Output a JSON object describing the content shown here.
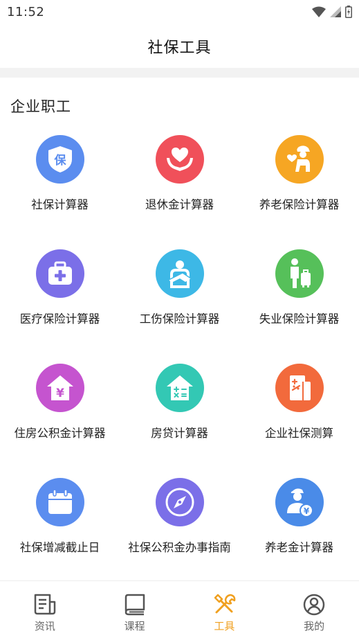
{
  "status_bar": {
    "time": "11:52"
  },
  "header": {
    "title": "社保工具"
  },
  "section": {
    "title": "企业职工"
  },
  "tools": [
    {
      "label": "社保计算器",
      "color": "#5b8def",
      "icon": "shield-bao-icon",
      "glyph": "保"
    },
    {
      "label": "退休金计算器",
      "color": "#f0505a",
      "icon": "heart-hands-icon"
    },
    {
      "label": "养老保险计算器",
      "color": "#f6a623",
      "icon": "elder-care-icon"
    },
    {
      "label": "医疗保险计算器",
      "color": "#7b6fe8",
      "icon": "medical-kit-icon"
    },
    {
      "label": "工伤保险计算器",
      "color": "#3db8e6",
      "icon": "injured-person-icon"
    },
    {
      "label": "失业保险计算器",
      "color": "#56c05a",
      "icon": "person-luggage-icon"
    },
    {
      "label": "住房公积金计算器",
      "color": "#c554cf",
      "icon": "house-yen-icon",
      "glyph": "¥"
    },
    {
      "label": "房贷计算器",
      "color": "#33c8b4",
      "icon": "house-calculator-icon"
    },
    {
      "label": "企业社保测算",
      "color": "#f26a3c",
      "icon": "enterprise-calc-icon"
    },
    {
      "label": "社保增减截止日",
      "color": "#5b8def",
      "icon": "calendar-icon"
    },
    {
      "label": "社保公积金办事指南",
      "color": "#7b6fe8",
      "icon": "compass-icon"
    },
    {
      "label": "养老金计算器",
      "color": "#4a8be8",
      "icon": "pension-person-icon",
      "glyph": "¥"
    }
  ],
  "nav": {
    "items": [
      {
        "label": "资讯",
        "icon": "news-icon"
      },
      {
        "label": "课程",
        "icon": "book-icon"
      },
      {
        "label": "工具",
        "icon": "tools-icon"
      },
      {
        "label": "我的",
        "icon": "user-icon"
      }
    ],
    "active_color": "#f0a020",
    "inactive_color": "#555555"
  }
}
